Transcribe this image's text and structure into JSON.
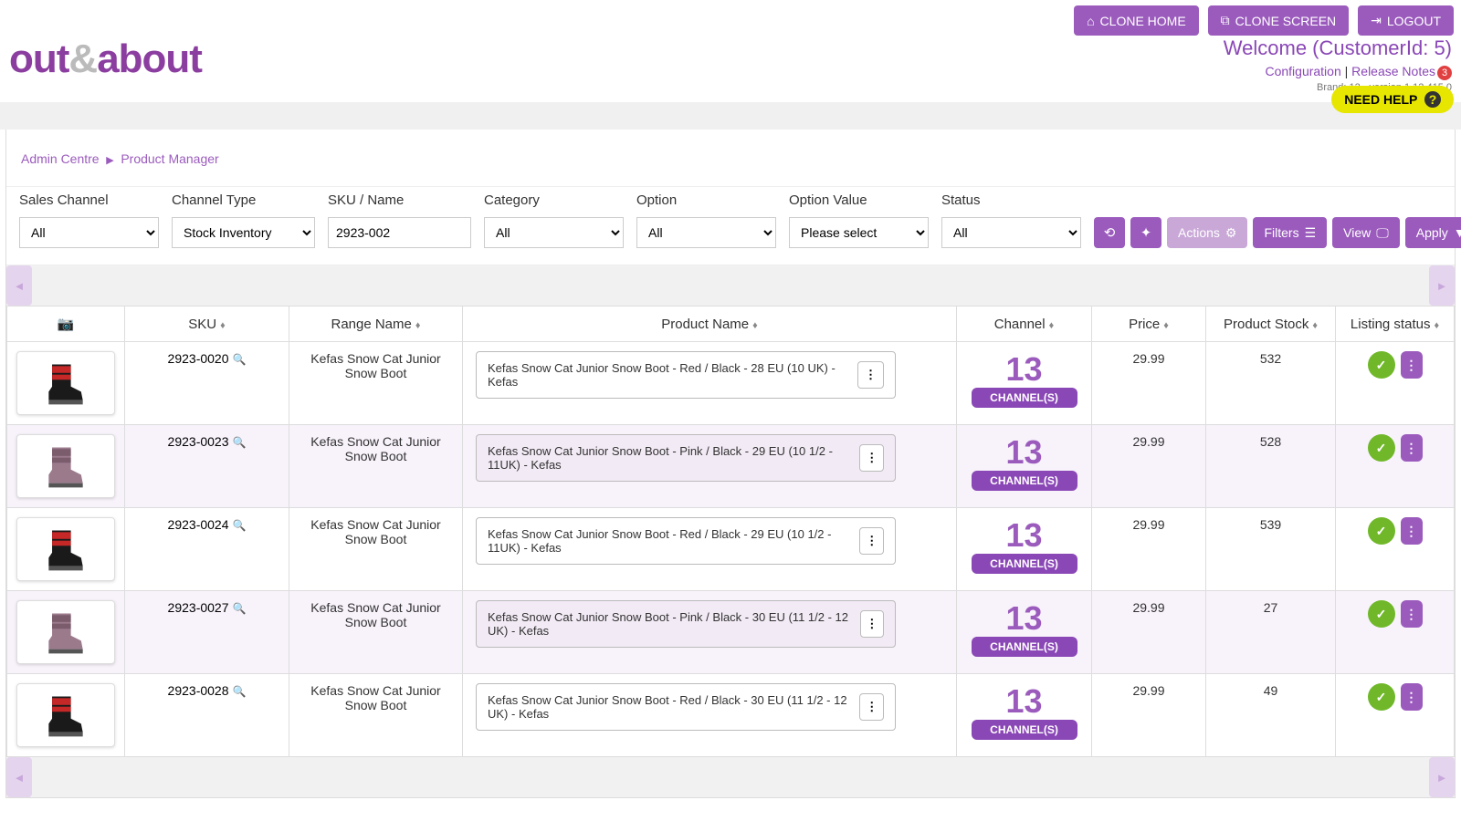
{
  "top_buttons": {
    "clone_home": "CLONE HOME",
    "clone_screen": "CLONE SCREEN",
    "logout": "LOGOUT"
  },
  "logo": {
    "part1": "out",
    "amp": "&",
    "part2": "about"
  },
  "header": {
    "welcome": "Welcome (CustomerId: 5)",
    "config": "Configuration",
    "release_notes": "Release Notes",
    "release_badge": "3",
    "brand": "Brand: 12 - version 1.12.415.0",
    "need_help": "NEED HELP"
  },
  "breadcrumb": {
    "root": "Admin Centre",
    "current": "Product Manager"
  },
  "filters": {
    "labels": {
      "sales_channel": "Sales Channel",
      "channel_type": "Channel Type",
      "sku_name": "SKU / Name",
      "category": "Category",
      "option": "Option",
      "option_value": "Option Value",
      "status": "Status"
    },
    "values": {
      "sales_channel": "All",
      "channel_type": "Stock Inventory",
      "sku_name": "2923-002",
      "category": "All",
      "option": "All",
      "option_value": "Please select",
      "status": "All"
    },
    "buttons": {
      "actions": "Actions",
      "filters": "Filters",
      "view": "View",
      "apply": "Apply"
    }
  },
  "table": {
    "headers": {
      "sku": "SKU",
      "range": "Range Name",
      "product": "Product Name",
      "channel": "Channel",
      "price": "Price",
      "stock": "Product Stock",
      "status": "Listing status"
    },
    "rows": [
      {
        "color": "red",
        "sku": "2923-0020",
        "range": "Kefas Snow Cat Junior Snow Boot",
        "name": "Kefas Snow Cat Junior Snow Boot - Red / Black - 28 EU (10 UK) - Kefas",
        "channels": "13",
        "channels_label": "CHANNEL(S)",
        "price": "29.99",
        "stock": "532"
      },
      {
        "color": "pink",
        "sku": "2923-0023",
        "range": "Kefas Snow Cat Junior Snow Boot",
        "name": "Kefas Snow Cat Junior Snow Boot - Pink / Black - 29 EU (10 1/2 - 11UK) - Kefas",
        "channels": "13",
        "channels_label": "CHANNEL(S)",
        "price": "29.99",
        "stock": "528"
      },
      {
        "color": "red",
        "sku": "2923-0024",
        "range": "Kefas Snow Cat Junior Snow Boot",
        "name": "Kefas Snow Cat Junior Snow Boot - Red / Black - 29 EU (10 1/2 - 11UK) - Kefas",
        "channels": "13",
        "channels_label": "CHANNEL(S)",
        "price": "29.99",
        "stock": "539"
      },
      {
        "color": "pink",
        "sku": "2923-0027",
        "range": "Kefas Snow Cat Junior Snow Boot",
        "name": "Kefas Snow Cat Junior Snow Boot - Pink / Black - 30 EU (11 1/2 - 12 UK) - Kefas",
        "channels": "13",
        "channels_label": "CHANNEL(S)",
        "price": "29.99",
        "stock": "27"
      },
      {
        "color": "red",
        "sku": "2923-0028",
        "range": "Kefas Snow Cat Junior Snow Boot",
        "name": "Kefas Snow Cat Junior Snow Boot - Red / Black - 30 EU (11 1/2 - 12 UK) - Kefas",
        "channels": "13",
        "channels_label": "CHANNEL(S)",
        "price": "29.99",
        "stock": "49"
      }
    ]
  }
}
